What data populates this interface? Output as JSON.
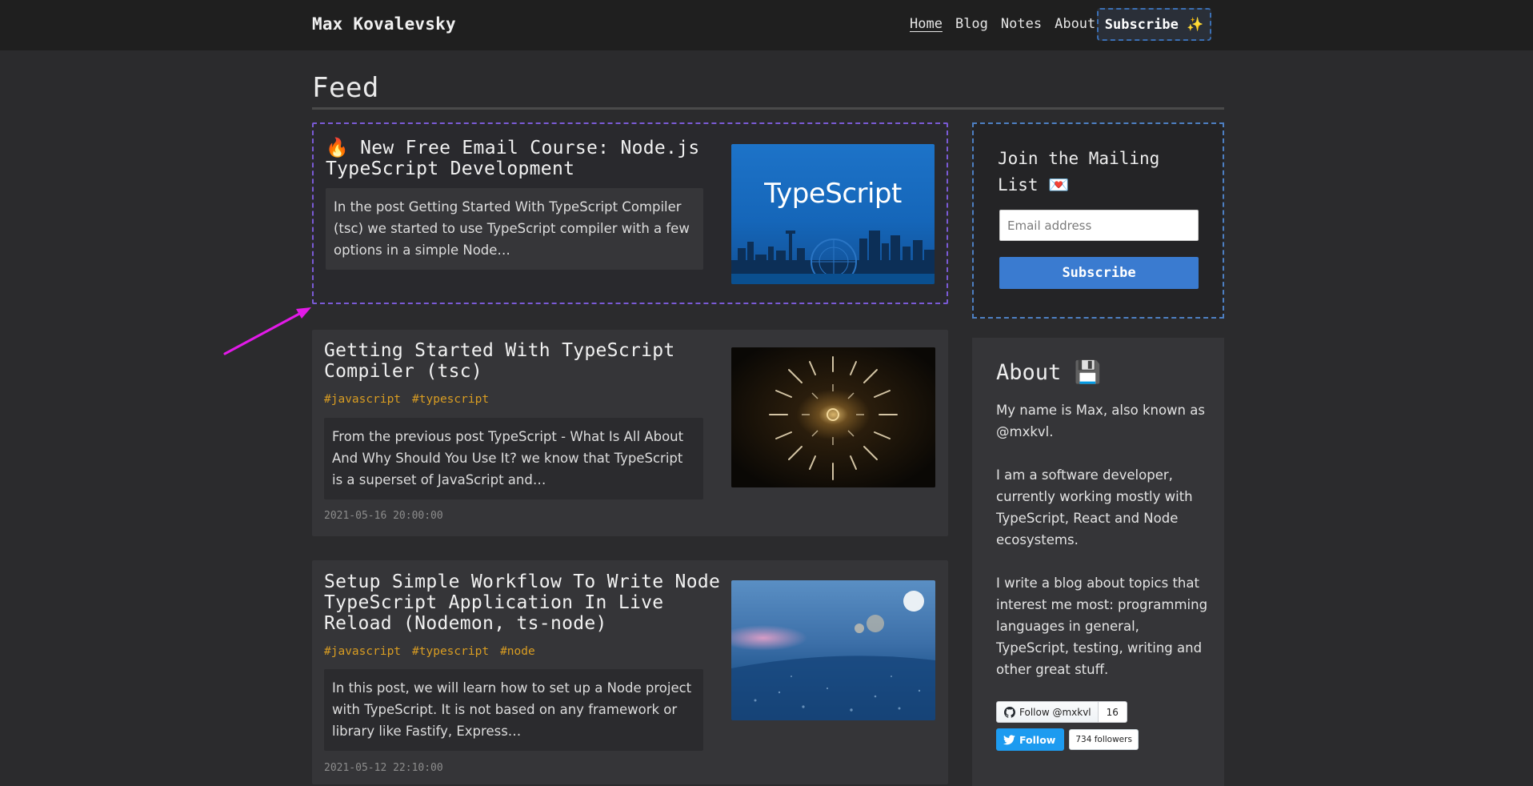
{
  "header": {
    "brand": "Max Kovalevsky",
    "nav": [
      "Home",
      "Blog",
      "Notes",
      "About"
    ],
    "subscribe_label": "Subscribe ✨"
  },
  "page": {
    "title": "Feed"
  },
  "promo": {
    "title": "🔥 New Free Email Course: Node.js TypeScript Development",
    "excerpt": "In the post Getting Started With TypeScript Compiler (tsc) we started to use TypeScript compiler with a few options in a simple Node…",
    "image_text": "TypeScript"
  },
  "posts": [
    {
      "title": "Getting Started With TypeScript Compiler (tsc)",
      "tags": [
        "#javascript",
        "#typescript"
      ],
      "excerpt": "From the previous post TypeScript - What Is All About And Why Should You Use It? we know that TypeScript is a superset of JavaScript and…",
      "date": "2021-05-16 20:00:00"
    },
    {
      "title": "Setup Simple Workflow To Write Node TypeScript Application In Live Reload (Nodemon, ts-node)",
      "tags": [
        "#javascript",
        "#typescript",
        "#node"
      ],
      "excerpt": "In this post, we will learn how to set up a Node project with TypeScript. It is not based on any framework or library like Fastify, Express…",
      "date": "2021-05-12 22:10:00"
    }
  ],
  "mailing": {
    "title": "Join the Mailing List 💌",
    "email_placeholder": "Email address",
    "email_value": "",
    "subscribe_label": "Subscribe"
  },
  "about": {
    "title": "About 💾",
    "paragraphs": [
      "My name is Max, also known as @mxkvl.",
      "I am a software developer, currently working mostly with TypeScript, React and Node ecosystems.",
      "I write a blog about topics that interest me most: programming languages in general, TypeScript, testing, writing and other great stuff."
    ],
    "github": {
      "label": "Follow @mxkvl",
      "count": "16"
    },
    "twitter": {
      "label": "Follow",
      "count": "734 followers"
    }
  },
  "colors": {
    "background": "#2b2b2d",
    "header": "#1f1f1f",
    "tag": "#d99d22",
    "promo_border": "#7a5ad6",
    "accent": "#3a7bd0",
    "annotation_arrow": "#e21ae8"
  }
}
